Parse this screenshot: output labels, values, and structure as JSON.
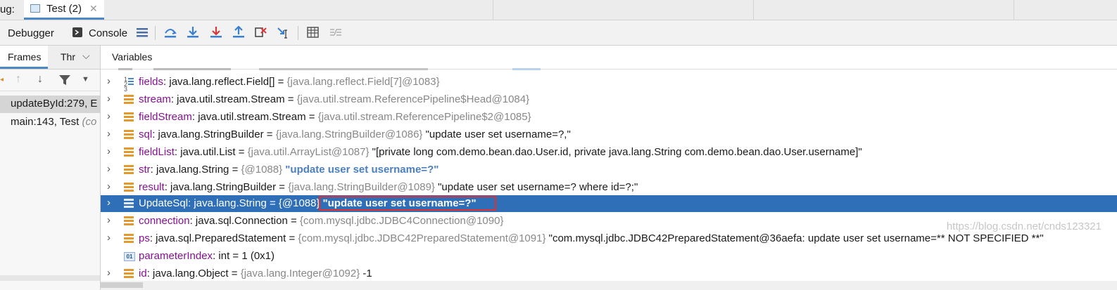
{
  "tabstrip": {
    "prefix": "ug:",
    "tab_label": "Test (2)",
    "close": "✕"
  },
  "toolbar": {
    "debugger_label": "Debugger",
    "console_label": "Console"
  },
  "frames": {
    "tab_frames": "Frames",
    "tab_threads": "Thr",
    "items": [
      {
        "label": "updateById:279, E"
      },
      {
        "label": "main:143, Test ",
        "hint": "(co"
      }
    ]
  },
  "variables": {
    "header": "Variables",
    "rows": [
      {
        "name": "fields",
        "type": ": java.lang.reflect.Field[]  = ",
        "ref": "{java.lang.reflect.Field[7]@1083}",
        "value": ""
      },
      {
        "name": "stream",
        "type": ": java.util.stream.Stream  = ",
        "ref": "{java.util.stream.ReferencePipeline$Head@1084}",
        "value": ""
      },
      {
        "name": "fieldStream",
        "type": ": java.util.stream.Stream  = ",
        "ref": "{java.util.stream.ReferencePipeline$2@1085}",
        "value": ""
      },
      {
        "name": "sql",
        "type": ": java.lang.StringBuilder  = ",
        "ref": "{java.lang.StringBuilder@1086}",
        "value": " \"update user set username=?,\""
      },
      {
        "name": "fieldList",
        "type": ": java.util.List  = ",
        "ref": "{java.util.ArrayList@1087}",
        "value": " \"[private long com.demo.bean.dao.User.id, private java.lang.String com.demo.bean.dao.User.username]\""
      },
      {
        "name": "str",
        "type": ": java.lang.String  = ",
        "ref": "{@1088}",
        "value": " \"update user set username=?\""
      },
      {
        "name": "result",
        "type": ": java.lang.StringBuilder  = ",
        "ref": "{java.lang.StringBuilder@1089}",
        "value": " \"update user set username=? where id=?;\""
      },
      {
        "name": "UpdateSql",
        "type": ": java.lang.String  = ",
        "ref": "{@1088}",
        "value": "\"update user set username=?\""
      },
      {
        "name": "connection",
        "type": ": java.sql.Connection  = ",
        "ref": "{com.mysql.jdbc.JDBC4Connection@1090}",
        "value": ""
      },
      {
        "name": "ps",
        "type": ": java.sql.PreparedStatement  = ",
        "ref": "{com.mysql.jdbc.JDBC42PreparedStatement@1091}",
        "value": " \"com.mysql.jdbc.JDBC42PreparedStatement@36aefa: update user set username=** NOT SPECIFIED **\""
      },
      {
        "name": "parameterIndex",
        "type": ": int  = 1 (0x1)",
        "ref": "",
        "value": ""
      },
      {
        "name": "id",
        "type": ": java.lang.Object  = ",
        "ref": "{java.lang.Integer@1092}",
        "value": " -1"
      }
    ]
  },
  "watermark": "https://blog.csdn.net/cnds123321",
  "colors": {
    "selection": "#2f6fb8",
    "highlight_box": "#e03030",
    "var_name": "#871094"
  }
}
